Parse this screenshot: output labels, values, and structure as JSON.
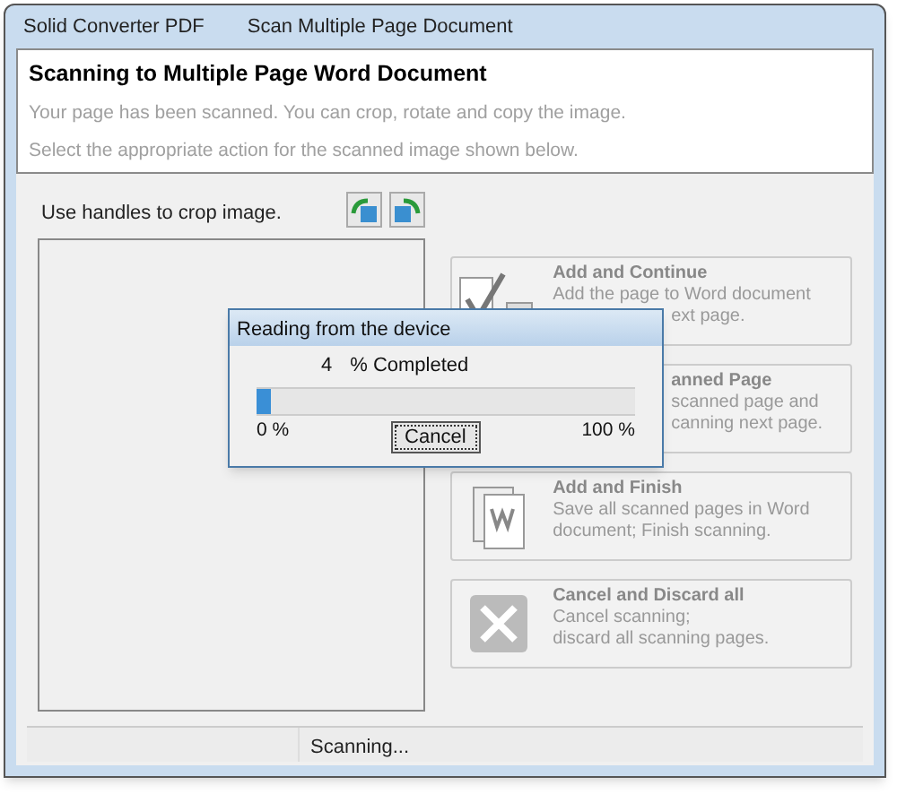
{
  "window": {
    "app": "Solid Converter PDF",
    "title": "Scan Multiple Page Document"
  },
  "header": {
    "title": "Scanning to Multiple Page Word Document",
    "lines": [
      "Your page has been scanned. You can crop, rotate and copy the image.",
      "Select the appropriate action for the scanned image shown below."
    ]
  },
  "crop": {
    "label": "Use handles to crop image."
  },
  "actions": [
    {
      "kind": "check",
      "title": "Add and Continue",
      "lines": [
        "Add the page to Word document",
        "ext page."
      ],
      "hidden_start": [
        false,
        false,
        true
      ]
    },
    {
      "kind": "scan",
      "title": "anned Page",
      "lines": [
        "scanned page and",
        "canning next page."
      ],
      "hidden_start": [
        true,
        true,
        true
      ]
    },
    {
      "kind": "word",
      "title": "Add and Finish",
      "lines": [
        "Save all scanned pages in Word",
        "document; Finish scanning."
      ],
      "hidden_start": [
        false,
        false,
        false
      ]
    },
    {
      "kind": "cancel",
      "title": "Cancel and Discard all",
      "lines": [
        "Cancel scanning;",
        "discard all scanning pages."
      ],
      "hidden_start": [
        false,
        false,
        false
      ]
    }
  ],
  "dialog": {
    "title": "Reading from the device",
    "percent": "4",
    "percent_label": "% Completed",
    "level": 0.04,
    "min_label": "0 %",
    "max_label": "100 %",
    "button": "Cancel"
  },
  "status_bar": {
    "text": "Scanning..."
  }
}
